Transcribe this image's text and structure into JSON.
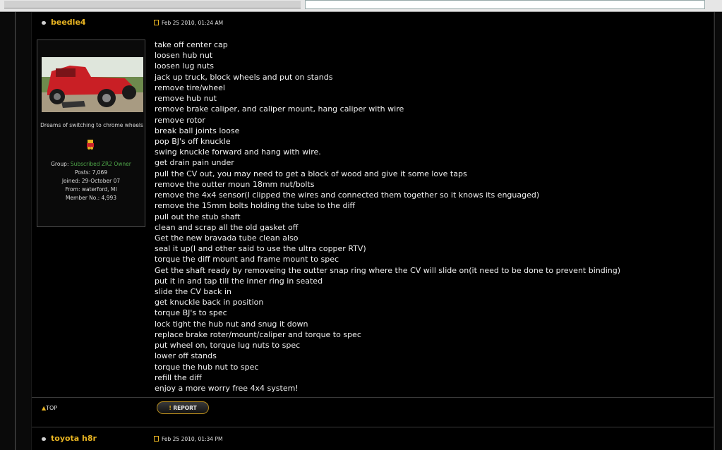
{
  "post1": {
    "author": "beedle4",
    "date": "Feb 25 2010, 01:24 AM",
    "signature": "Dreams of switching to chrome wheels",
    "stats": {
      "group_label": "Group:",
      "group_value": "Subscribed ZR2 Owner",
      "posts": "Posts: 7,069",
      "joined": "Joined: 29-October 07",
      "from": "From: waterford, MI",
      "member_no": "Member No.: 4,993"
    },
    "lines": [
      "take off center cap",
      "loosen hub nut",
      "loosen lug nuts",
      "jack up truck, block wheels and put on stands",
      "remove tire/wheel",
      "remove hub nut",
      "remove brake caliper, and caliper mount, hang caliper with wire",
      "remove rotor",
      "break ball joints loose",
      "pop BJ's off knuckle",
      "swing knuckle forward and hang with wire.",
      "get drain pain under",
      "pull the CV out, you may need to get a block of wood and give it some love taps",
      "remove the outter moun 18mm nut/bolts",
      "remove the 4x4 sensor(I clipped the wires and connected them together so it knows its enguaged)",
      "remove the 15mm bolts holding the tube to the diff",
      "pull out the stub shaft",
      "clean and scrap all the old gasket off",
      "Get the new bravada tube clean also",
      "seal it up(I and other said to use the ultra copper RTV)",
      "torque the diff mount and frame mount to spec",
      "Get the shaft ready by removeing the outter snap ring where the CV will slide on(it need to be done to prevent binding)",
      "put it in and tap till the inner ring in seated",
      "slide the CV back in",
      "get knuckle back in position",
      "torque BJ's to spec",
      "lock tight the hub nut and snug it down",
      "replace brake roter/mount/caliper and torque to spec",
      "put wheel on, torque lug nuts to spec",
      "lower off stands",
      "torque the hub nut to spec",
      "refill the diff",
      "enjoy a more worry free 4x4 system!"
    ]
  },
  "footer": {
    "top_label": "TOP",
    "report_label": "REPORT"
  },
  "post2": {
    "author": "toyota h8r",
    "date": "Feb 25 2010, 01:34 PM"
  }
}
